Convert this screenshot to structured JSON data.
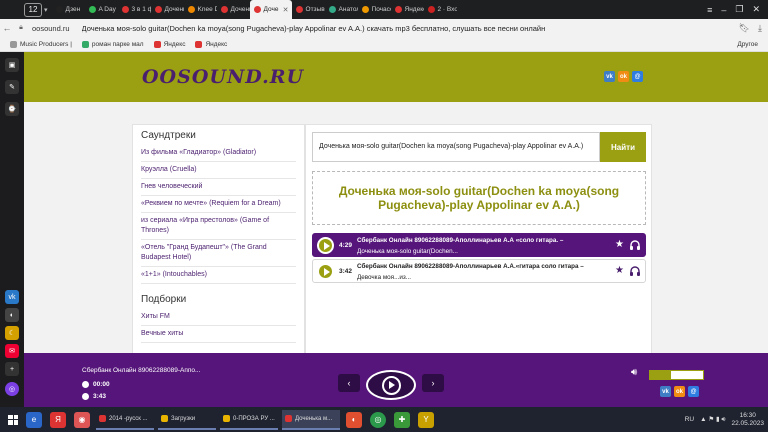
{
  "browser": {
    "tab_count": "12",
    "tabs": [
      {
        "label": "Дзен",
        "color": "#222"
      },
      {
        "label": "A Day b",
        "color": "#3b5"
      },
      {
        "label": "3 в 1 ф",
        "color": "#d33"
      },
      {
        "label": "Доченьк",
        "color": "#d33"
      },
      {
        "label": "Knee De",
        "color": "#e80"
      },
      {
        "label": "Доченьк",
        "color": "#d33"
      },
      {
        "label": "Доче",
        "color": "#d33",
        "active": true
      },
      {
        "label": "Отзыв",
        "color": "#d33"
      },
      {
        "label": "Анатол",
        "color": "#3a8"
      },
      {
        "label": "Почасо",
        "color": "#e90"
      },
      {
        "label": "Яндекс",
        "color": "#d33"
      },
      {
        "label": "2 · Вход",
        "color": "#c22"
      }
    ],
    "url": "oosound.ru",
    "page_title": "Доченька моя-solo guitar(Dochen ka moya(song Pugacheva)-play Appolinar ev A.A.) скачать mp3 бесплатно, слушать все песни онлайн",
    "bookmarks": [
      {
        "label": "Music Producers |",
        "color": "#999"
      },
      {
        "label": "роман парке мал",
        "color": "#3a6"
      },
      {
        "label": "Яндекс",
        "color": "#d33"
      },
      {
        "label": "Яндекс",
        "color": "#d33"
      }
    ],
    "bookmarks_other": "Другое"
  },
  "site": {
    "logo": "OOSOUND.RU",
    "sidebar": {
      "section1_title": "Саундтреки",
      "section1_items": [
        "Из фильма «Гладиатор» (Gladiator)",
        "Круэлла (Cruella)",
        "Гнев человеческий",
        "«Реквием по мечте» (Requiem for a Dream)",
        "из сериала «Игра престолов» (Game of Thrones)",
        "«Отель \"Гранд Будапешт\"» (The Grand Budapest Hotel)",
        "«1+1» (Intouchables)"
      ],
      "section2_title": "Подборки",
      "section2_items": [
        "Хиты FM",
        "Вечные хиты"
      ]
    },
    "search": {
      "value": "Доченька моя-solo guitar(Dochen ka moya(song Pugacheva)-play Appolinar ev A.A.)",
      "button": "Найти"
    },
    "heading": "Доченька моя-solo guitar(Dochen ka moya(song Pugacheva)-play Appolinar ev A.A.)",
    "tracks": [
      {
        "duration": "4:29",
        "title": "Сбербанк Онлайн 89062288089-Аполлинарьев А.А «соло гитара. –",
        "subtitle": "Доченька моя-solo guitar(Dochen...",
        "active": true
      },
      {
        "duration": "3:42",
        "title": "Сбербанк Онлайн 89062288089-Аполлинарьев А.А.«гитара соло гитара –",
        "subtitle": "Девочка моя...из...",
        "active": false
      }
    ]
  },
  "player": {
    "title": "Сбербанк Онлайн 89062288089-Аппо...",
    "current_time": "00:00",
    "total_time": "3:43",
    "volume": 0.4
  },
  "taskbar": {
    "tasks": [
      {
        "label": "2014 -русск ...",
        "color": "#d33"
      },
      {
        "label": "Загрузки",
        "color": "#e8b400"
      },
      {
        "label": "0-ПРОЗА РУ ...",
        "color": "#e8b400"
      },
      {
        "label": "Доченька м...",
        "color": "#d33",
        "active": true
      }
    ],
    "lang": "RU",
    "time": "16:30",
    "date": "22.05.2023"
  },
  "colors": {
    "olive": "#9aa012",
    "purple": "#55157a"
  }
}
